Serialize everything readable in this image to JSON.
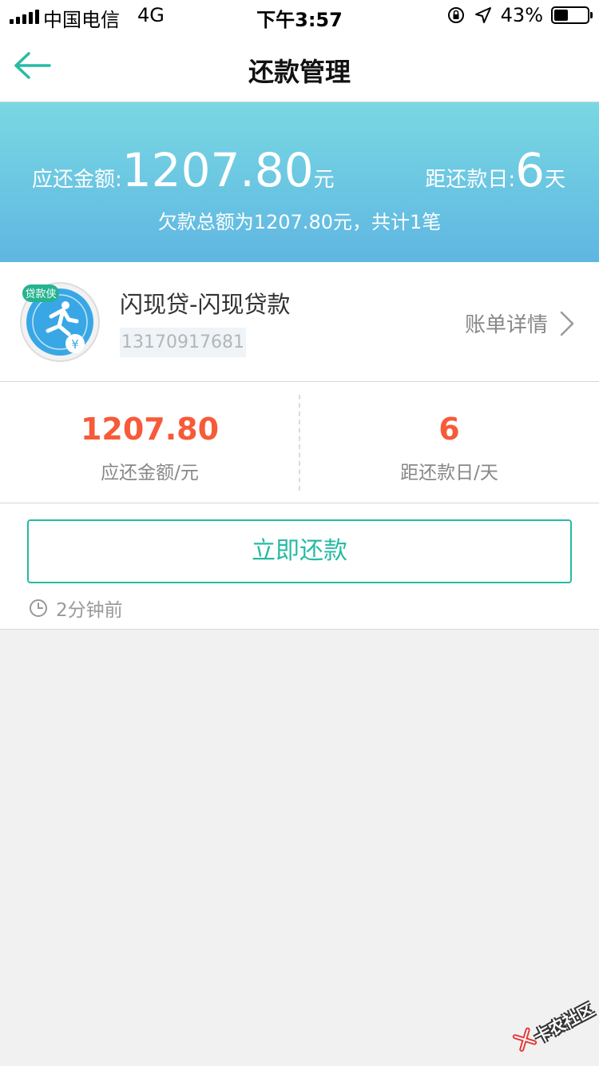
{
  "status_bar": {
    "carrier": "中国电信",
    "network": "4G",
    "time": "下午3:57",
    "battery": "43%",
    "battery_level": 0.43
  },
  "nav": {
    "title": "还款管理",
    "back_icon": "arrow-left-icon"
  },
  "banner": {
    "due_label": "应还金额:",
    "due_amount": "1207.80",
    "due_unit": "元",
    "days_label": "距还款日:",
    "days_value": "6",
    "days_unit": "天",
    "summary": "欠款总额为1207.80元，共计1笔"
  },
  "account": {
    "logo_icon": "runner-logo-icon",
    "logo_badge": "贷款侠",
    "name": "闪现贷-闪现贷款",
    "phone": "13170917681",
    "bill_link": "账单详情"
  },
  "stats": {
    "amount_value": "1207.80",
    "amount_label": "应还金额/元",
    "days_value": "6",
    "days_label": "距还款日/天"
  },
  "pay": {
    "button_label": "立即还款",
    "timestamp": "2分钟前"
  },
  "watermark": {
    "text": "卡农社区"
  },
  "colors": {
    "accent": "#27bba3",
    "highlight": "#f75a38",
    "banner_top": "#79d8e2",
    "banner_bottom": "#5fb6e2"
  }
}
